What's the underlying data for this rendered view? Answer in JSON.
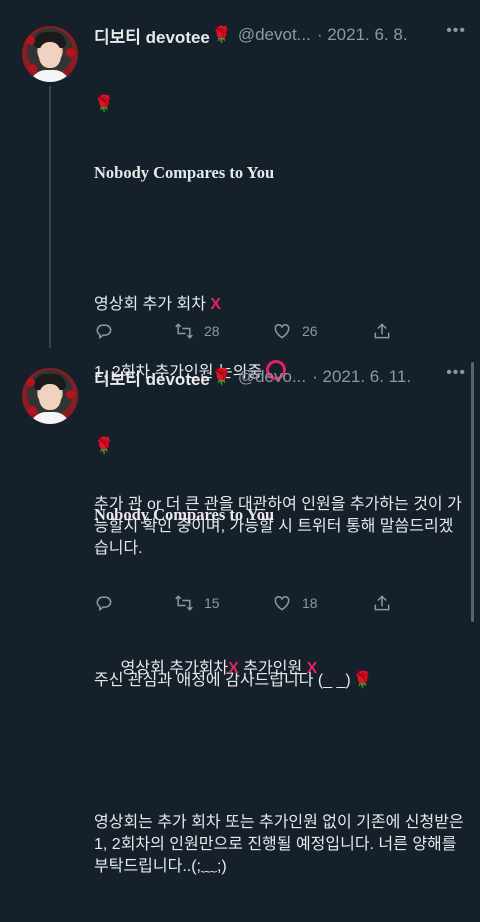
{
  "colors": {
    "background": "#15202b",
    "text": "#e7e9ea",
    "muted": "#8b98a5",
    "accent_red": "#e0245e"
  },
  "tweets": [
    {
      "name": "디보티 devotee",
      "handle": "@devot...",
      "date": "· 2021. 6. 8.",
      "rose": "🌹",
      "title": "Nobody Compares to You",
      "line1": "영상회 추가 회차",
      "line1_mark": "X",
      "line2": "1, 2회차 추가인원 논의중",
      "para1": "추가 관 or 더 큰 관을 대관하여 인원을 추가하는 것이 가능할지 확인 중이며, 가능할 시 트위터 통해 말씀드리겠습니다.",
      "para2": "주신 관심과 애정에 감사드립니다 (_ _)",
      "replies": "",
      "retweets": "28",
      "likes": "26"
    },
    {
      "name": "디보티 devotee",
      "handle": "@devo...",
      "date": "· 2021. 6. 11.",
      "rose": "🌹",
      "title": "Nobody Compares to You",
      "line1a": "영상회 추가회차",
      "line1b": " 추가인원 ",
      "line1_mark": "X",
      "para1": "영상회는 추가 회차 또는 추가인원 없이 기존에 신청받은 1, 2회차의 인원만으로 진행될 예정입니다. 너른 양해를 부탁드립니다..(;﹏;)",
      "replies": "",
      "retweets": "15",
      "likes": "18"
    }
  ],
  "icons": [
    "reply-icon",
    "retweet-icon",
    "like-icon",
    "share-icon",
    "more-icon"
  ]
}
